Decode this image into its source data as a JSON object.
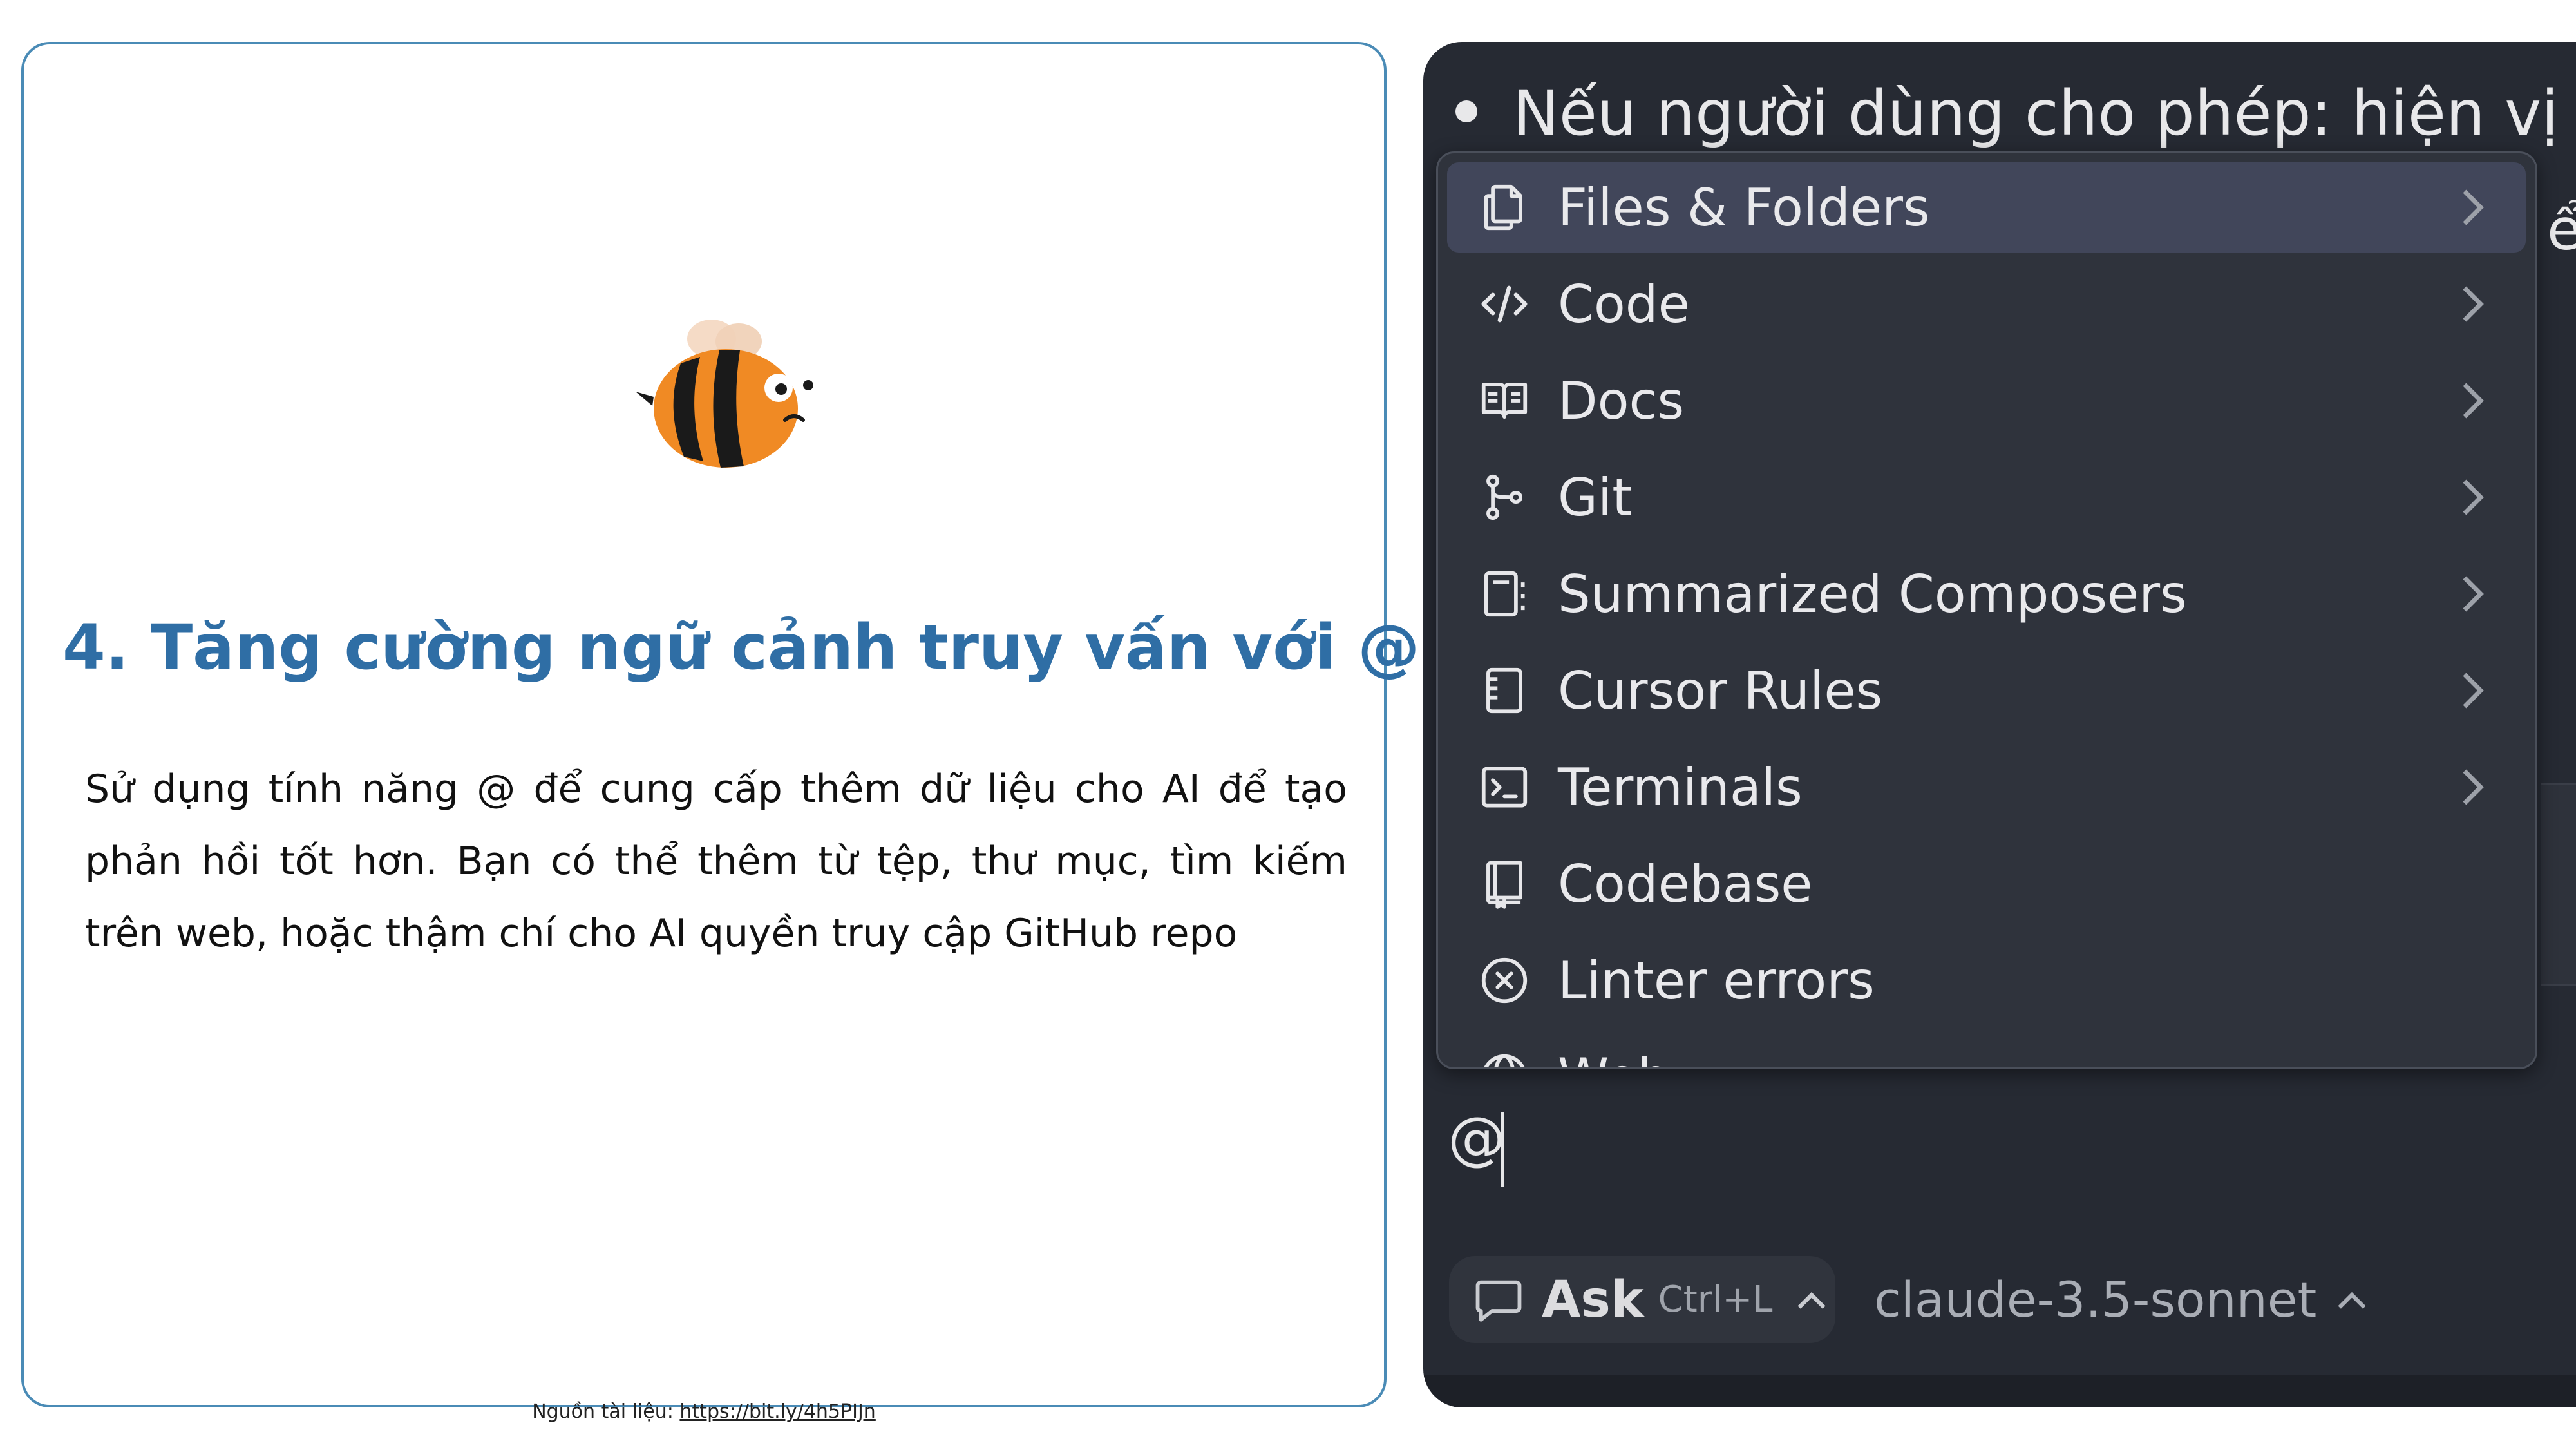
{
  "slide": {
    "title": "4. Tăng cường ngữ cảnh truy vấn với @",
    "body": "Sử dụng tính năng @ để cung cấp thêm dữ liệu cho AI để tạo phản hồi tốt hơn. Bạn có thể thêm từ tệp, thư mục, tìm kiếm trên web, hoặc thậm chí cho AI quyền truy cập GitHub repo",
    "source_label": "Nguồn tài liệu: ",
    "source_link": "https://bit.ly/4h5PIJn",
    "accent_color": "#2f6ea5",
    "border_color": "#4a8bb6"
  },
  "editor": {
    "bullet_text": "Nếu người dùng cho phép: hiện vị trí",
    "peek_char": "ể",
    "menu_items": [
      {
        "label": "Files & Folders",
        "icon": "files-icon",
        "has_submenu": true,
        "highlighted": true
      },
      {
        "label": "Code",
        "icon": "code-icon",
        "has_submenu": true
      },
      {
        "label": "Docs",
        "icon": "book-icon",
        "has_submenu": true
      },
      {
        "label": "Git",
        "icon": "git-branch-icon",
        "has_submenu": true
      },
      {
        "label": "Summarized Composers",
        "icon": "composer-icon",
        "has_submenu": true
      },
      {
        "label": "Cursor Rules",
        "icon": "rules-icon",
        "has_submenu": true
      },
      {
        "label": "Terminals",
        "icon": "terminal-icon",
        "has_submenu": true
      },
      {
        "label": "Codebase",
        "icon": "codebase-icon",
        "has_submenu": false
      },
      {
        "label": "Linter errors",
        "icon": "error-circle-icon",
        "has_submenu": false
      },
      {
        "label": "Web",
        "icon": "globe-icon",
        "has_submenu": false
      }
    ],
    "input_value": "@",
    "ask_label": "Ask",
    "ask_shortcut": "Ctrl+L",
    "model_name": "claude-3.5-sonnet",
    "bg_color": "#262a33",
    "menu_bg": "#2f333c",
    "highlight_bg": "#41465a"
  }
}
